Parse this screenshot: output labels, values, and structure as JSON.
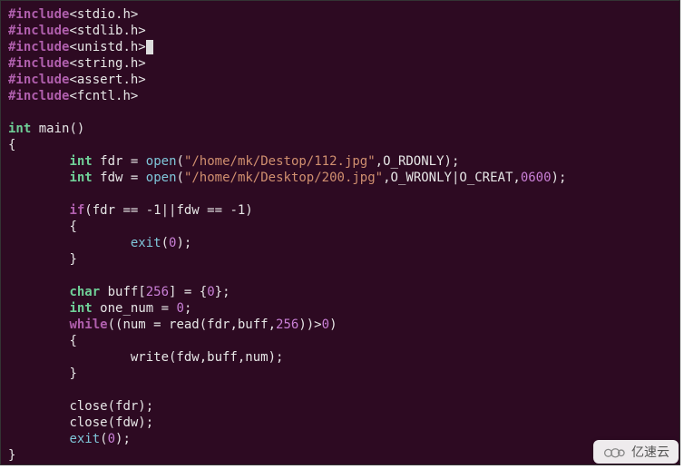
{
  "includes": [
    "<stdio.h>",
    "<stdlib.h>",
    "<unistd.h>",
    "<string.h>",
    "<assert.h>",
    "<fcntl.h>"
  ],
  "sig": {
    "ret": "int",
    "name": "main",
    "params": "()"
  },
  "open1": {
    "decl": "int",
    "var": "fdr",
    "path": "\"/home/mk/Destop/112.jpg\"",
    "flags": "O_RDONLY"
  },
  "open2": {
    "decl": "int",
    "var": "fdw",
    "path": "\"/home/mk/Desktop/200.jpg\"",
    "flags": "O_WRONLY|O_CREAT",
    "mode": "0600"
  },
  "ifc": {
    "cond": "(fdr == -1||fdw == -1)",
    "body": "exit(0);"
  },
  "buf": {
    "decl": "char",
    "name": "buff",
    "size": "256",
    "init": "0"
  },
  "one": {
    "decl": "int",
    "name": "one_num",
    "init": "0"
  },
  "loop": {
    "kw": "while",
    "cond_pre": "((num = read(fdr,buff,",
    "cond_num": "256",
    "cond_post": "))>",
    "cond_zero": "0",
    "cond_end": ")",
    "body": "write(fdw,buff,num);"
  },
  "closes": [
    "close(fdr);",
    "close(fdw);"
  ],
  "exit": "exit(0);",
  "kw_include": "#include",
  "kw_if": "if",
  "fn_open": "open",
  "fn_exit": "exit",
  "watermark": "亿速云"
}
